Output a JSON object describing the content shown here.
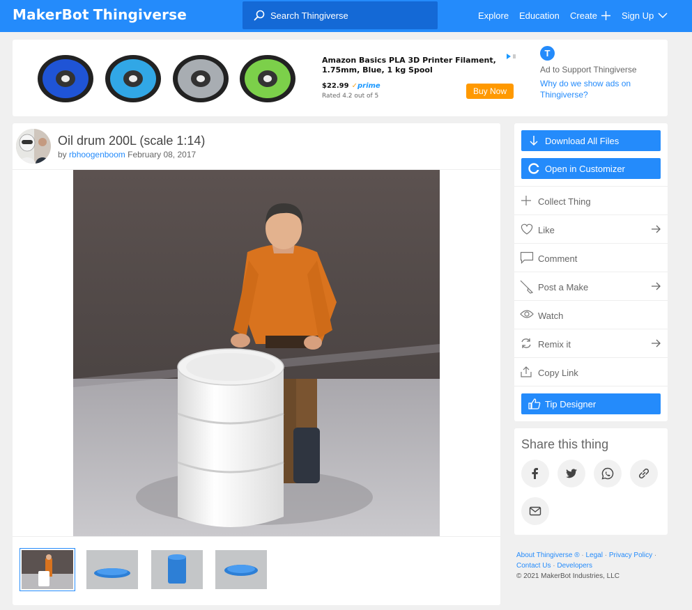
{
  "header": {
    "logo_brand": "MakerBot",
    "logo_product": "Thingiverse",
    "search_placeholder": "Search Thingiverse",
    "nav": {
      "explore": "Explore",
      "education": "Education",
      "create": "Create",
      "signup": "Sign Up"
    }
  },
  "ad": {
    "product_title": "Amazon Basics PLA 3D Printer Filament, 1.75mm, Blue, 1 kg Spool",
    "price": "$22.99",
    "prime": "prime",
    "rating": "Rated 4.2 out of 5",
    "buy_label": "Buy Now",
    "logo_letter": "T",
    "support_text": "Ad to Support Thingiverse",
    "why_text": "Why do we show ads on Thingiverse?",
    "spool_colors": [
      "#1f54d6",
      "#31a7e6",
      "#a8adb2",
      "#7cd04a"
    ]
  },
  "thing": {
    "title": "Oil drum 200L (scale 1:14)",
    "by": "by",
    "author": "rbhoogenboom",
    "date": "February 08, 2017"
  },
  "actions": {
    "download": "Download All Files",
    "customizer": "Open in Customizer",
    "collect": "Collect Thing",
    "like": "Like",
    "comment": "Comment",
    "post_make": "Post a Make",
    "watch": "Watch",
    "remix": "Remix it",
    "copy_link": "Copy Link",
    "tip": "Tip Designer"
  },
  "share": {
    "title": "Share this thing"
  },
  "footer": {
    "about": "About Thingiverse ®",
    "legal": "Legal",
    "privacy": "Privacy Policy",
    "contact": "Contact Us",
    "developers": "Developers",
    "copyright": "© 2021 MakerBot Industries, LLC"
  },
  "colors": {
    "brand": "#248bfb",
    "buy": "#ff9900"
  }
}
